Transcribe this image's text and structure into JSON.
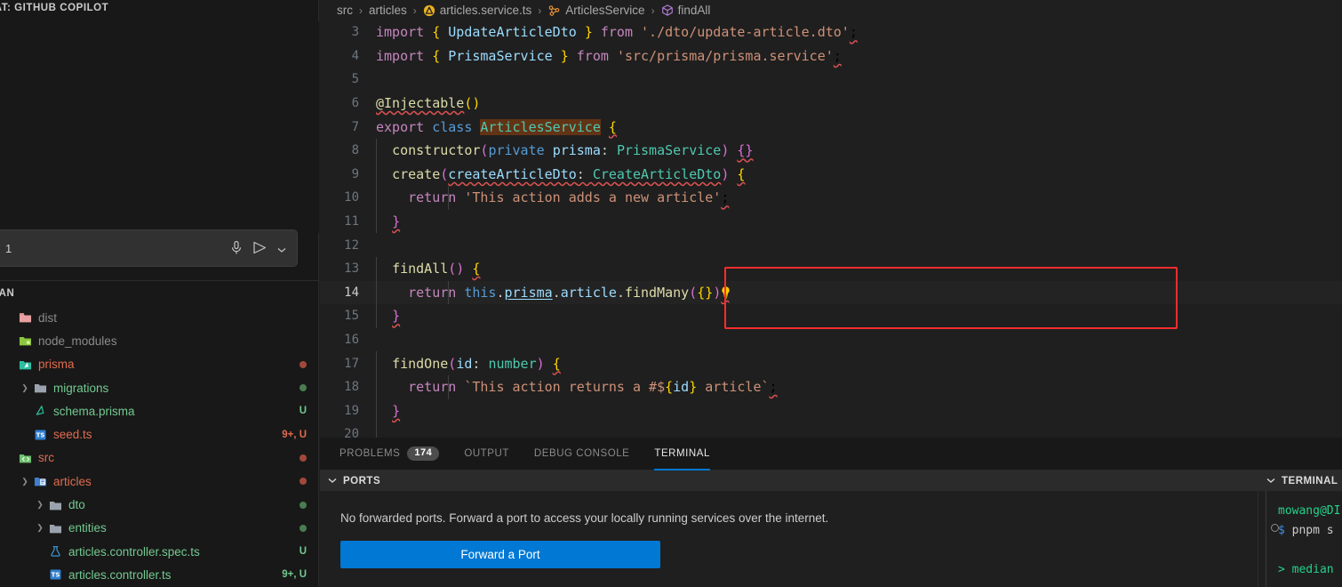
{
  "chat": {
    "title": "CHAT: GITHUB COPILOT",
    "input_value": "1",
    "mic_icon": "microphone-icon",
    "send_icon": "send-icon",
    "chevron_icon": "chevron-down-icon"
  },
  "explorer": {
    "title": "EDIAN",
    "items": [
      {
        "twisty": "",
        "icon": "folder-dist-icon",
        "label": "dist",
        "color": "#8b8b8b",
        "status": "",
        "dot": "",
        "indent": 0
      },
      {
        "twisty": "",
        "icon": "folder-node-icon",
        "label": "node_modules",
        "color": "#8b8b8b",
        "status": "",
        "dot": "",
        "indent": 0
      },
      {
        "twisty": "",
        "icon": "folder-prisma-icon",
        "label": "prisma",
        "color": "#e06c4e",
        "status": "",
        "dot": "#a1483a",
        "indent": 0
      },
      {
        "twisty": "›",
        "icon": "folder-icon",
        "label": "migrations",
        "color": "#73c991",
        "status": "",
        "dot": "#4a7c52",
        "indent": 1
      },
      {
        "twisty": "",
        "icon": "prisma-file-icon",
        "label": "schema.prisma",
        "color": "#73c991",
        "status": "U",
        "dot": "",
        "indent": 1
      },
      {
        "twisty": "",
        "icon": "ts-file-icon",
        "label": "seed.ts",
        "color": "#e06c4e",
        "status": "9+, U",
        "dot": "",
        "indent": 1
      },
      {
        "twisty": "",
        "icon": "folder-src-icon",
        "label": "src",
        "color": "#e06c4e",
        "status": "",
        "dot": "#a1483a",
        "indent": 0
      },
      {
        "twisty": "›",
        "icon": "folder-articles-icon",
        "label": "articles",
        "color": "#e06c4e",
        "status": "",
        "dot": "#a1483a",
        "indent": 1
      },
      {
        "twisty": "›",
        "icon": "folder-icon",
        "label": "dto",
        "color": "#73c991",
        "status": "",
        "dot": "#4a7c52",
        "indent": 2
      },
      {
        "twisty": "›",
        "icon": "folder-icon",
        "label": "entities",
        "color": "#73c991",
        "status": "",
        "dot": "#4a7c52",
        "indent": 2
      },
      {
        "twisty": "",
        "icon": "test-flask-icon",
        "label": "articles.controller.spec.ts",
        "color": "#73c991",
        "status": "U",
        "dot": "",
        "indent": 2
      },
      {
        "twisty": "",
        "icon": "ts-file-icon",
        "label": "articles.controller.ts",
        "color": "#73c991",
        "status": "9+, U",
        "dot": "",
        "indent": 2
      }
    ]
  },
  "breadcrumb": [
    {
      "label": "src",
      "icon": ""
    },
    {
      "label": "articles",
      "icon": ""
    },
    {
      "label": "articles.service.ts",
      "icon": "nestjs-file-icon"
    },
    {
      "label": "ArticlesService",
      "icon": "class-symbol-icon"
    },
    {
      "label": "findAll",
      "icon": "method-symbol-icon"
    }
  ],
  "code": {
    "active_line": 14,
    "lightbulb_icon": "lightbulb-quickfix-icon",
    "lines": [
      {
        "n": "3",
        "text": "import { UpdateArticleDto } from './dto/update-article.dto';"
      },
      {
        "n": "4",
        "text": "import { PrismaService } from 'src/prisma/prisma.service';"
      },
      {
        "n": "5",
        "text": ""
      },
      {
        "n": "6",
        "text": "@Injectable()"
      },
      {
        "n": "7",
        "text": "export class ArticlesService {"
      },
      {
        "n": "8",
        "text": "  constructor(private prisma: PrismaService) {}"
      },
      {
        "n": "9",
        "text": "  create(createArticleDto: CreateArticleDto) {"
      },
      {
        "n": "10",
        "text": "    return 'This action adds a new article';"
      },
      {
        "n": "11",
        "text": "  }"
      },
      {
        "n": "12",
        "text": ""
      },
      {
        "n": "13",
        "text": "  findAll() {"
      },
      {
        "n": "14",
        "text": "    return this.prisma.article.findMany({});"
      },
      {
        "n": "15",
        "text": "  }"
      },
      {
        "n": "16",
        "text": ""
      },
      {
        "n": "17",
        "text": "  findOne(id: number) {"
      },
      {
        "n": "18",
        "text": "    return `This action returns a #${id} article`;"
      },
      {
        "n": "19",
        "text": "  }"
      },
      {
        "n": "20",
        "text": ""
      }
    ],
    "highlight_box_color": "#fb2c2c"
  },
  "panel": {
    "tabs": [
      {
        "label": "PROBLEMS",
        "badge": "174",
        "active": false
      },
      {
        "label": "OUTPUT",
        "badge": "",
        "active": false
      },
      {
        "label": "DEBUG CONSOLE",
        "badge": "",
        "active": false
      },
      {
        "label": "TERMINAL",
        "badge": "",
        "active": true
      }
    ]
  },
  "ports": {
    "title": "PORTS",
    "chevron_icon": "chevron-down-icon",
    "message": "No forwarded ports. Forward a port to access your locally running services over the internet.",
    "button_label": "Forward a Port",
    "button_color": "#0078d4"
  },
  "terminal": {
    "title": "TERMINAL",
    "chevron_icon": "chevron-down-icon",
    "lines": [
      {
        "text": "mowang@DI",
        "cls": "t-green"
      },
      {
        "text": "$ pnpm s",
        "cls": "t-prompt"
      },
      {
        "text": "",
        "cls": "t-white"
      },
      {
        "text": "> median",
        "cls": "t-arrow"
      }
    ]
  },
  "accent": "#0078d4"
}
